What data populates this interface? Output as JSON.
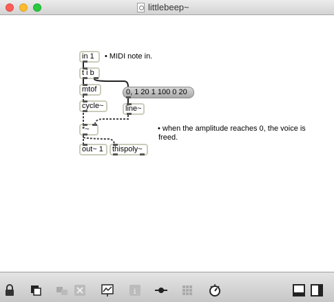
{
  "window": {
    "title": "littlebeep~"
  },
  "patch": {
    "obj_in": "in 1",
    "obj_tib": "t i b",
    "obj_mtof": "mtof",
    "obj_cycle": "cycle~",
    "obj_line": "line~",
    "obj_mul": "*~",
    "obj_out": "out~ 1",
    "obj_thispoly": "thispoly~",
    "msg_env": "0, 1 20 1 100 0 20",
    "comment_midi": "• MIDI note in.",
    "comment_amp_1": "• when the amplitude reaches 0, the voice is",
    "comment_amp_2": "freed."
  },
  "toolbar": {
    "icons": [
      "lock-icon",
      "new-object-icon",
      "group-icon",
      "delete-icon",
      "presentation-icon",
      "inspector-icon",
      "connect-icon",
      "grid-icon",
      "clue-icon",
      "patcher-view-icon",
      "presentation-view-icon"
    ]
  }
}
